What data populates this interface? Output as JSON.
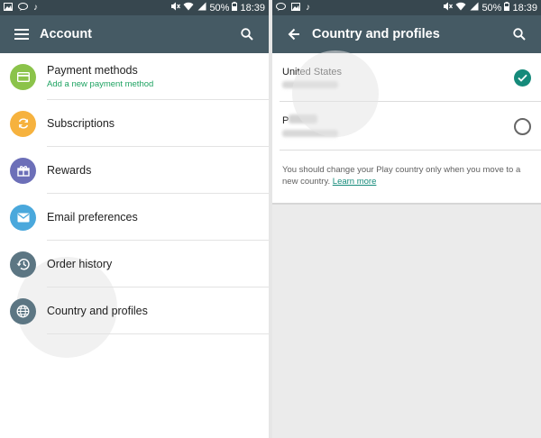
{
  "status": {
    "time": "18:39",
    "battery": "50%"
  },
  "account": {
    "title": "Account",
    "items": [
      {
        "label": "Payment methods",
        "sub": "Add a new payment method",
        "color": "#8bc34a",
        "icon": "credit-card-icon"
      },
      {
        "label": "Subscriptions",
        "sub": "",
        "color": "#f6b23e",
        "icon": "sync-icon"
      },
      {
        "label": "Rewards",
        "sub": "",
        "color": "#6c6fb8",
        "icon": "gift-icon"
      },
      {
        "label": "Email preferences",
        "sub": "",
        "color": "#4aa8dc",
        "icon": "email-icon"
      },
      {
        "label": "Order history",
        "sub": "",
        "color": "#5c7683",
        "icon": "history-icon"
      },
      {
        "label": "Country and profiles",
        "sub": "",
        "color": "#5c7683",
        "icon": "globe-icon"
      }
    ]
  },
  "country": {
    "title": "Country and profiles",
    "profiles": [
      {
        "name": "United States",
        "selected": true
      },
      {
        "name": "P",
        "selected": false
      }
    ],
    "note": "You should change your Play country only when you move to a new country.",
    "learn_more": "Learn more"
  },
  "colors": {
    "toolbar": "#455a64",
    "statusbar": "#37474f",
    "accent": "#158a7a",
    "link_green": "#1ea362"
  }
}
